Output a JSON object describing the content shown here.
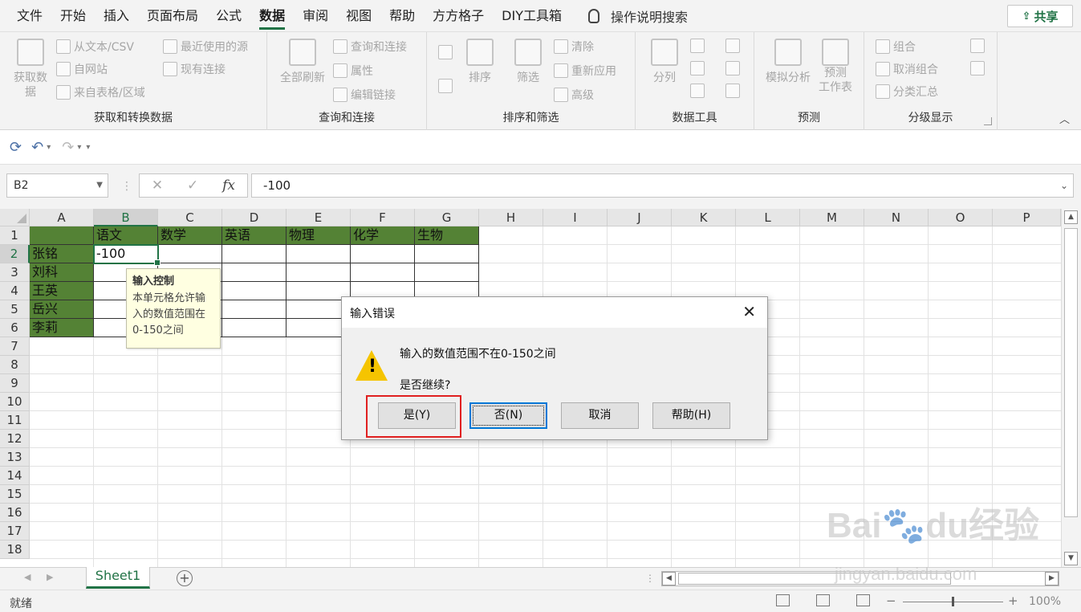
{
  "menu": {
    "tabs": [
      "文件",
      "开始",
      "插入",
      "页面布局",
      "公式",
      "数据",
      "审阅",
      "视图",
      "帮助",
      "方方格子",
      "DIY工具箱"
    ],
    "active_tab": "数据",
    "search_label": "操作说明搜索",
    "share_label": "共享"
  },
  "ribbon": {
    "get_data": {
      "big_label": "获取数\n据",
      "items": [
        "从文本/CSV",
        "自网站",
        "来自表格/区域",
        "最近使用的源",
        "现有连接"
      ],
      "group_label": "获取和转换数据"
    },
    "queries": {
      "big_label": "全部刷新",
      "items": [
        "查询和连接",
        "属性",
        "编辑链接"
      ],
      "group_label": "查询和连接"
    },
    "sort_filter": {
      "sort_label": "排序",
      "filter_label": "筛选",
      "items": [
        "清除",
        "重新应用",
        "高级"
      ],
      "group_label": "排序和筛选"
    },
    "data_tools": {
      "split_label": "分列",
      "group_label": "数据工具"
    },
    "forecast": {
      "whatif_label": "模拟分析",
      "sheet_label": "预测\n工作表",
      "group_label": "预测"
    },
    "outline": {
      "items": [
        "组合",
        "取消组合",
        "分类汇总"
      ],
      "group_label": "分级显示"
    }
  },
  "formula_bar": {
    "name_box": "B2",
    "formula": "-100"
  },
  "grid": {
    "columns": [
      "A",
      "B",
      "C",
      "D",
      "E",
      "F",
      "G",
      "H",
      "I",
      "J",
      "K",
      "L",
      "M",
      "N",
      "O",
      "P"
    ],
    "rows": [
      "1",
      "2",
      "3",
      "4",
      "5",
      "6",
      "7",
      "8",
      "9",
      "10",
      "11",
      "12",
      "13",
      "14",
      "15",
      "16",
      "17",
      "18"
    ],
    "headers": [
      "语文",
      "数学",
      "英语",
      "物理",
      "化学",
      "生物"
    ],
    "names": [
      "张铭",
      "刘科",
      "王英",
      "岳兴",
      "李莉"
    ],
    "b2_value": "-100",
    "header_color": "#548235",
    "accent_color": "#217346"
  },
  "tooltip": {
    "title": "输入控制",
    "body": "本单元格允许输入的数值范围在0-150之间"
  },
  "dialog": {
    "title": "输入错误",
    "message": "输入的数值范围不在0-150之间",
    "question": "是否继续?",
    "buttons": {
      "yes": "是(Y)",
      "no": "否(N)",
      "cancel": "取消",
      "help": "帮助(H)"
    }
  },
  "sheets": {
    "tabs": [
      "Sheet1"
    ]
  },
  "status": {
    "ready": "就绪",
    "zoom": "100%"
  }
}
